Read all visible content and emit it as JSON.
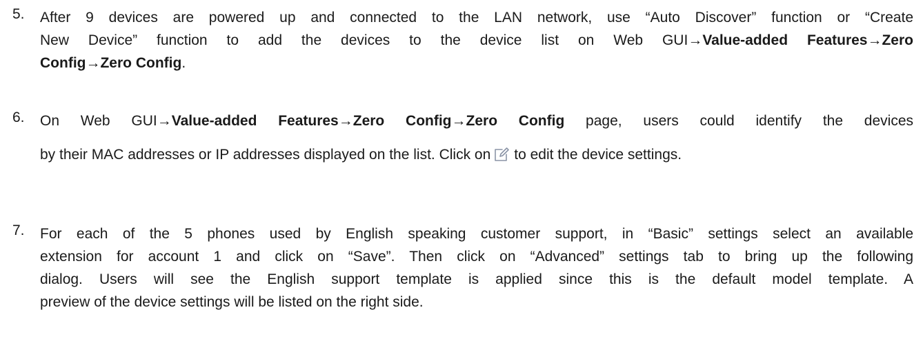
{
  "item5": {
    "number": "5.",
    "line1": "After 9 devices are powered up and connected to the LAN network, use “Auto Discover” function or “Create",
    "line2_a": "New Device” function to add the devices to the device list on Web GUI",
    "line2_b": "Value-added Features",
    "line2_c": "Zero",
    "line3_a": "Config",
    "line3_b": "Zero Config",
    "line3_end": "."
  },
  "item6": {
    "number": "6.",
    "line1_a": "On Web GUI",
    "line1_b": "Value-added Features",
    "line1_c": "Zero Config",
    "line1_d": "Zero Config",
    "line1_e": " page, users could identify the devices",
    "line2_a": "by their MAC addresses or IP addresses displayed on the list. Click on",
    "line2_b": "to edit the device settings.",
    "icon": "edit-icon"
  },
  "item7": {
    "number": "7.",
    "line1": "For each of the 5 phones used by English speaking customer support, in “Basic” settings select an available",
    "line2": "extension for account 1 and click on “Save”. Then click on “Advanced” settings tab to bring up the following",
    "line3": "dialog. Users will see the English support template is applied since this is the default model template. A",
    "line4": "preview of the device settings will be listed on the right side."
  },
  "arrow": "→",
  "colors": {
    "text": "#1a1a1a",
    "icon": "#8a94a6"
  }
}
